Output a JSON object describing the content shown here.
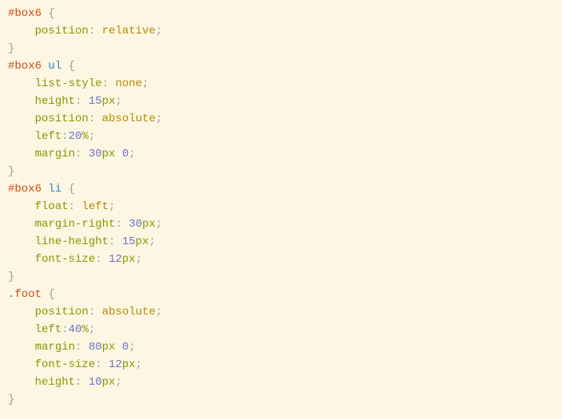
{
  "selectors": {
    "box6": "#box6",
    "box6ul": "#box6",
    "box6li": "#box6",
    "foot": ".foot"
  },
  "tags": {
    "ul": "ul",
    "li": "li"
  },
  "props": {
    "position": "position",
    "liststyle": "list-style",
    "height": "height",
    "left": "left",
    "margin": "margin",
    "float": "float",
    "marginright": "margin-right",
    "lineheight": "line-height",
    "fontsize": "font-size"
  },
  "kw": {
    "relative": "relative",
    "none": "none",
    "absolute": "absolute",
    "left": "left"
  },
  "nums": {
    "n15": "15",
    "n20": "20",
    "n30": "30",
    "n0": "0",
    "n12": "12",
    "n40": "40",
    "n80": "80",
    "n10": "10"
  },
  "units": {
    "px": "px",
    "pct": "%"
  },
  "punct": {
    "ob": "{",
    "cb": "}",
    "colon": ":",
    "semi": ";",
    "colonsp": ": "
  },
  "ws": {
    "indent": "    ",
    "sp": " "
  }
}
